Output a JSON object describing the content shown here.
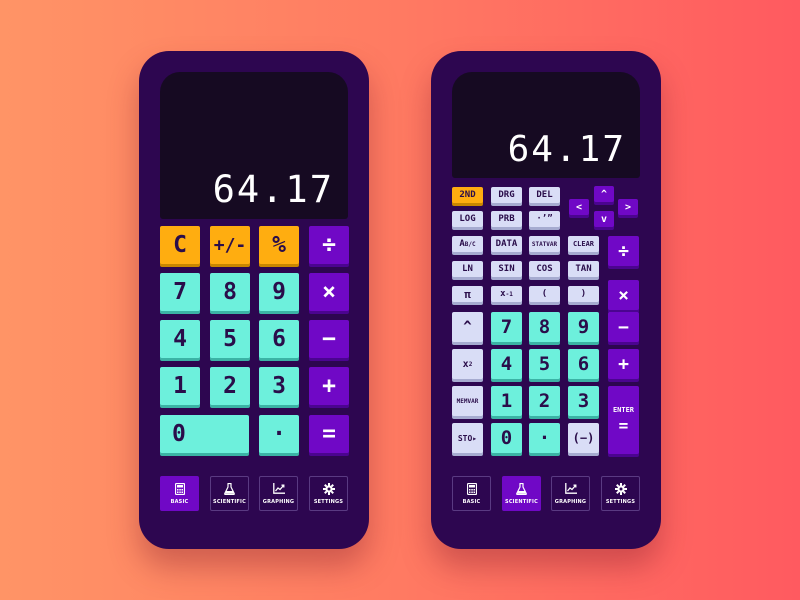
{
  "basic": {
    "display": "64.17",
    "keys": {
      "clear": "C",
      "plusminus": "+/-",
      "percent": "%",
      "divide": "÷",
      "seven": "7",
      "eight": "8",
      "nine": "9",
      "multiply": "×",
      "four": "4",
      "five": "5",
      "six": "6",
      "minus": "−",
      "one": "1",
      "two": "2",
      "three": "3",
      "plus": "+",
      "zero": "0",
      "decimal": "·",
      "equals": "="
    }
  },
  "scientific": {
    "display": "64.17",
    "keys": {
      "second": "2ND",
      "drg": "DRG",
      "del": "DEL",
      "log": "LOG",
      "prb": "PRB",
      "dms": "·’”",
      "abc": "A",
      "abc_sub": "B/C",
      "data": "DATA",
      "statvar": "STATVAR",
      "clear": "CLEAR",
      "ln": "LN",
      "sin": "SIN",
      "cos": "COS",
      "tan": "TAN",
      "pi": "π",
      "xinv": "x",
      "xinv_sup": "-1",
      "lparen": "(",
      "rparen": ")",
      "caret": "^",
      "xsq": "x",
      "xsq_sup": "2",
      "memvar": "MEMVAR",
      "sto": "STO▸",
      "seven": "7",
      "eight": "8",
      "nine": "9",
      "four": "4",
      "five": "5",
      "six": "6",
      "one": "1",
      "two": "2",
      "three": "3",
      "zero": "0",
      "decimal": "·",
      "neg": "(−)",
      "divide": "÷",
      "multiply": "×",
      "minus": "−",
      "plus": "+",
      "enter": "ENTER",
      "enter_eq": "=",
      "up": "^",
      "down": "v",
      "left": "<",
      "right": ">"
    }
  },
  "nav": {
    "basic": "BASIC",
    "scientific": "SCIENTIFIC",
    "graphing": "GRAPHING",
    "settings": "SETTINGS"
  },
  "active_tabs": {
    "left_phone": "BASIC",
    "right_phone": "SCIENTIFIC"
  },
  "colors": {
    "phone": "#2d0650",
    "screen": "#160a22",
    "teal": "#6df0dc",
    "orange": "#ffad10",
    "purple": "#7008c6",
    "lavender": "#d9ddf6"
  },
  "icons": [
    "calculator-icon",
    "flask-icon",
    "chart-icon",
    "gear-icon"
  ]
}
